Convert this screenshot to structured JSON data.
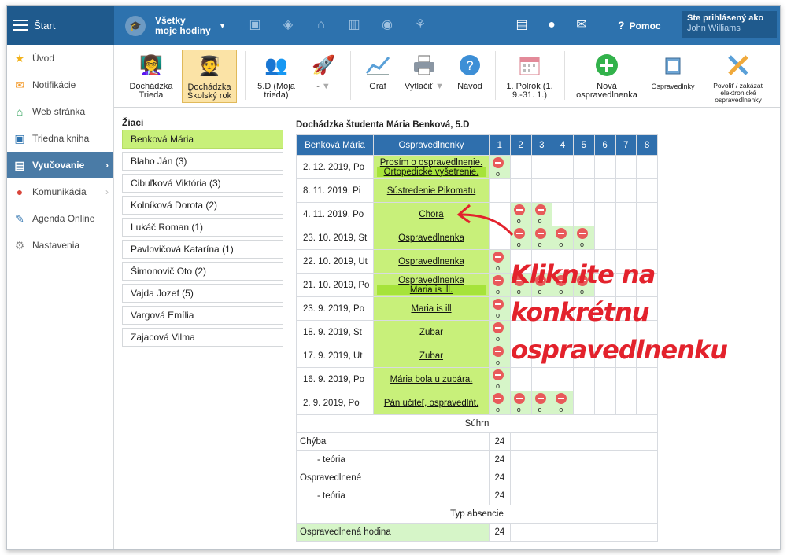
{
  "topbar": {
    "menu_label": "Štart",
    "selector_line1": "Všetky",
    "selector_line2": "moje hodiny",
    "help_label": "Pomoc",
    "user_line1": "Ste prihlásený ako",
    "user_line2": "John Williams"
  },
  "sidebar": {
    "items": [
      {
        "label": "Úvod",
        "icon": "star-icon"
      },
      {
        "label": "Notifikácie",
        "icon": "mail-icon"
      },
      {
        "label": "Web stránka",
        "icon": "home-icon"
      },
      {
        "label": "Triedna kniha",
        "icon": "book-icon"
      },
      {
        "label": "Vyučovanie",
        "icon": "book-open-icon"
      },
      {
        "label": "Komunikácia",
        "icon": "chat-icon"
      },
      {
        "label": "Agenda Online",
        "icon": "pen-icon"
      },
      {
        "label": "Nastavenia",
        "icon": "gear-icon"
      }
    ]
  },
  "toolbar": {
    "dochadzka_trieda_1": "Dochádzka",
    "dochadzka_trieda_2": "Trieda",
    "dochadzka_rok_1": "Dochádzka",
    "dochadzka_rok_2": "Školský rok",
    "class_1": "5.D (Moja",
    "class_2": "trieda)",
    "dash": "-",
    "graf": "Graf",
    "vytlacit": "Vytlačiť",
    "navod": "Návod",
    "polrok_1": "1. Polrok (1.",
    "polrok_2": "9.-31. 1.)",
    "nova_1": "Nová",
    "nova_2": "ospravedlnenka",
    "ospravedlnky": "Ospravedlnky",
    "povolit_1": "Povoliť / zakázať",
    "povolit_2": "elektronické",
    "povolit_3": "ospravedlnenky"
  },
  "students": {
    "heading": "Žiaci",
    "list": [
      "Benková Mária",
      "Blaho Ján (3)",
      "Cibuľková Viktória (3)",
      "Kolníková Dorota (2)",
      "Lukáč Roman (1)",
      "Pavlovičová Katarína (1)",
      "Šimonovič Oto (2)",
      "Vajda Jozef (5)",
      "Vargová Emília",
      "Zajacová Vilma"
    ]
  },
  "attendance": {
    "title": "Dochádzka študenta Mária Benková, 5.D",
    "col_student": "Benková Mária",
    "col_excuses": "Ospravedlnenky",
    "hours": [
      "1",
      "2",
      "3",
      "4",
      "5",
      "6",
      "7",
      "8"
    ],
    "rows": [
      {
        "date": "2. 12. 2019, Po",
        "excuse": [
          "Prosím o ospravedlnenie.",
          "Ortopedické vyšetrenie."
        ],
        "marks": [
          1
        ]
      },
      {
        "date": "8. 11. 2019, Pi",
        "excuse": [
          "Sústredenie Pikomatu"
        ],
        "marks": []
      },
      {
        "date": "4. 11. 2019, Po",
        "excuse": [
          "Chora"
        ],
        "marks": [
          2,
          3
        ]
      },
      {
        "date": "23. 10. 2019, St",
        "excuse": [
          "Ospravedlnenka"
        ],
        "marks": [
          2,
          3,
          4,
          5
        ]
      },
      {
        "date": "22. 10. 2019, Ut",
        "excuse": [
          "Ospravedlnenka"
        ],
        "marks": [
          1
        ]
      },
      {
        "date": "21. 10. 2019, Po",
        "excuse": [
          "Ospravedlnenka",
          "Maria is ill."
        ],
        "marks": [
          1,
          2,
          3,
          4,
          5
        ]
      },
      {
        "date": "23. 9. 2019, Po",
        "excuse": [
          "Maria is ill"
        ],
        "marks": [
          1
        ]
      },
      {
        "date": "18. 9. 2019, St",
        "excuse": [
          "Zubar"
        ],
        "marks": [
          1
        ]
      },
      {
        "date": "17. 9. 2019, Ut",
        "excuse": [
          "Zubar"
        ],
        "marks": [
          1
        ]
      },
      {
        "date": "16. 9. 2019, Po",
        "excuse": [
          "Mária bola u zubára."
        ],
        "marks": [
          1
        ]
      },
      {
        "date": "2. 9. 2019, Po",
        "excuse": [
          "Pán učiteľ, ospravedlňt."
        ],
        "marks": [
          1,
          2,
          3,
          4
        ]
      }
    ],
    "mark_symbol": "o",
    "summary_title": "Súhrn",
    "summary": [
      {
        "label": "Chýba",
        "value": "24",
        "indent": false
      },
      {
        "label": "- teória",
        "value": "24",
        "indent": true
      },
      {
        "label": "Ospravedlnené",
        "value": "24",
        "indent": false
      },
      {
        "label": "- teória",
        "value": "24",
        "indent": true
      }
    ],
    "type_title": "Typ absencie",
    "type_row_label": "Ospravedlnená hodina",
    "type_row_value": "24"
  },
  "callout": {
    "line1": "Kliknite na konkrétnu",
    "line2": "ospravedlnenku",
    "color": "#e3222c"
  }
}
